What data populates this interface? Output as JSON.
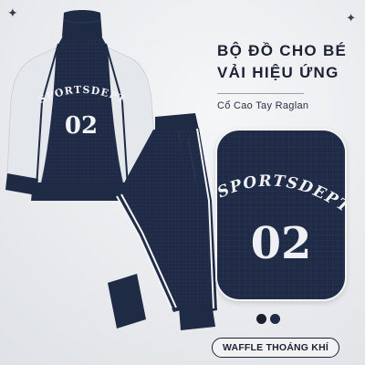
{
  "headline": {
    "line1": "BỘ ĐỒ CHO BÉ",
    "line2": "VẢI HIỆU ỨNG"
  },
  "subtitle": "Cổ Cao Tay Raglan",
  "product": {
    "chest_text": "SPORTSDEPT",
    "number": "02"
  },
  "zoom": {
    "arc_text": "SPORTSDEPT",
    "number": "02"
  },
  "colors": {
    "navy": "#1f2a44",
    "sleeve": "#e4e7ec",
    "stripe": "#f4f5f7",
    "background": "#e8eaed",
    "text_dark": "#1c2233"
  },
  "swatches": [
    "#1a1f2c",
    "#1f2a44"
  ],
  "feature_badge": "WAFFLE THOÁNG KHÍ",
  "icons": [
    "sparkle-icon",
    "sparkle-icon"
  ]
}
